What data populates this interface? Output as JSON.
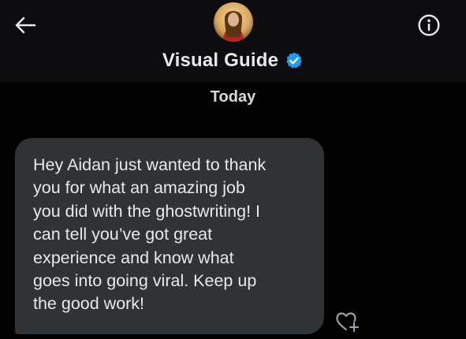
{
  "header": {
    "contact_name": "Visual Guide",
    "back_icon": "arrow-left-icon",
    "info_icon": "info-circle-icon",
    "verified_icon": "verified-badge-icon",
    "verified_color": "#1d9bf0"
  },
  "conversation": {
    "date_separator": "Today",
    "messages": [
      {
        "text": "Hey Aidan just wanted to thank\nyou for what an amazing job\nyou did with the ghostwriting! I\ncan tell you’ve got great\nexperience and know what\ngoes into going viral. Keep up\nthe good work!",
        "react_icon": "heart-plus-icon"
      }
    ]
  },
  "colors": {
    "background": "#000000",
    "header_background": "#0d0d0f",
    "bubble": "#2f3336",
    "text": "#e7e9ea"
  }
}
